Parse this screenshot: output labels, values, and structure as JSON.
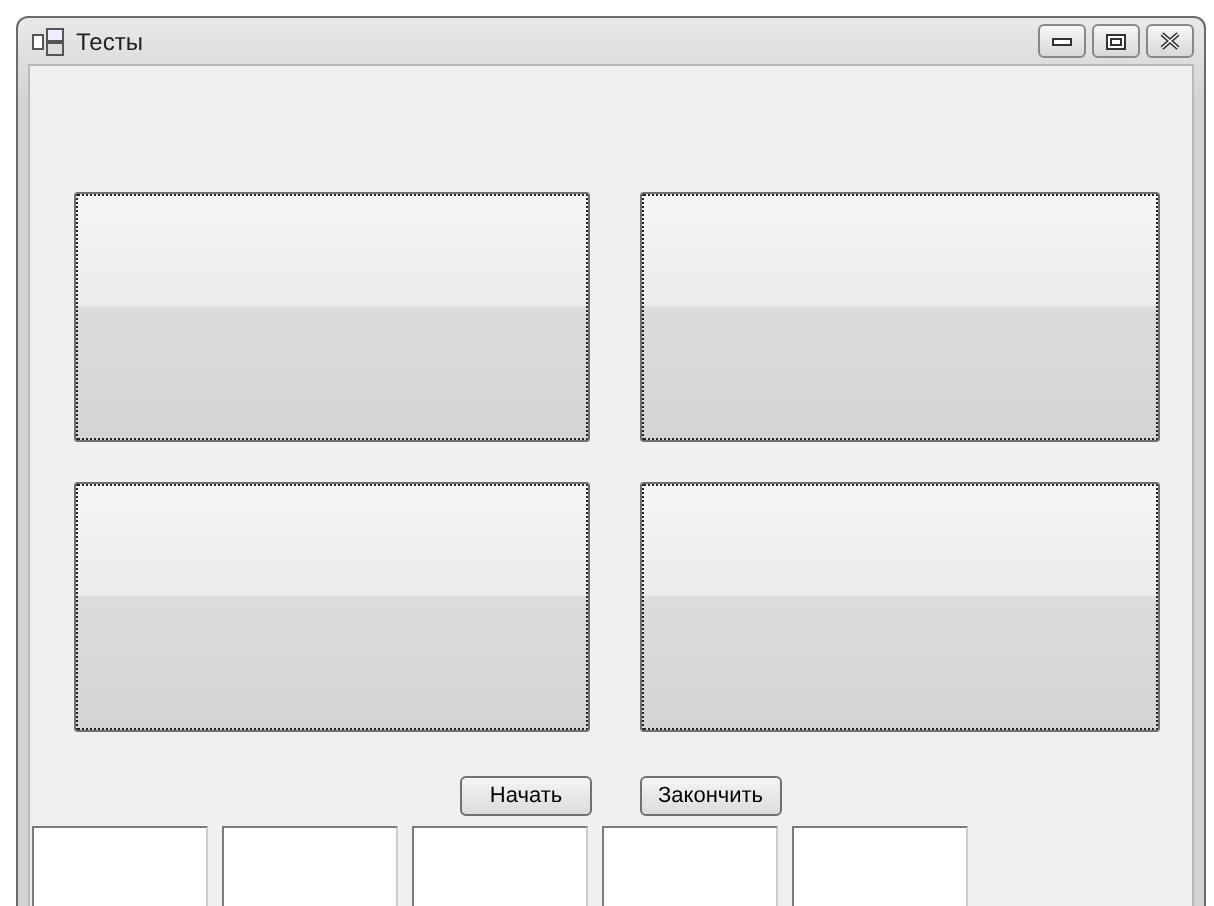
{
  "window": {
    "title": "Тесты"
  },
  "caption_buttons": [
    {
      "kind": "minimize"
    },
    {
      "kind": "maximize"
    },
    {
      "kind": "close"
    }
  ],
  "large_buttons": [
    {
      "focus_outline": true
    },
    {
      "focus_outline": true
    },
    {
      "focus_outline": true
    },
    {
      "focus_outline": true
    }
  ],
  "buttons": [
    {
      "label": "Начать"
    },
    {
      "label": "Закончить"
    }
  ],
  "text_boxes": [
    {
      "kind": "textbox"
    },
    {
      "kind": "textbox"
    },
    {
      "kind": "textbox"
    },
    {
      "kind": "textbox"
    },
    {
      "kind": "textbox"
    }
  ]
}
